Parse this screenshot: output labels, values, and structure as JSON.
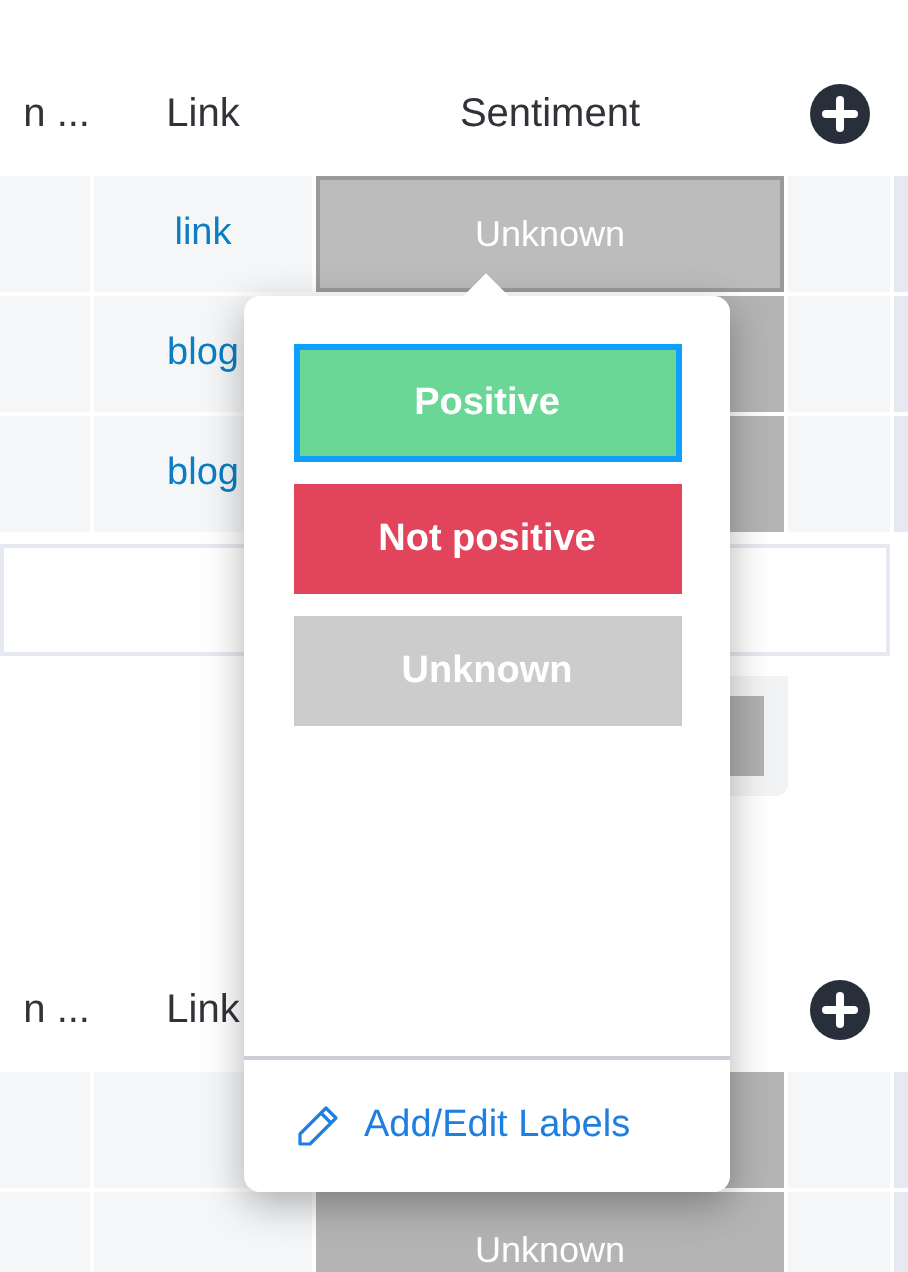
{
  "groups": [
    {
      "columns": [
        "n ...",
        "Link",
        "Sentiment"
      ],
      "rows": [
        {
          "link": "link",
          "sentiment": "Unknown",
          "focused": true
        },
        {
          "link": "blog",
          "focused": false
        },
        {
          "link": "blog",
          "focused": false
        }
      ],
      "summary": true
    },
    {
      "columns": [
        "n ...",
        "Link"
      ],
      "rows": [
        {
          "link": "",
          "focused": false
        },
        {
          "link": "",
          "sentiment": "Unknown",
          "focused": false
        }
      ],
      "summary": false
    }
  ],
  "picker": {
    "labels": [
      {
        "label": "Positive",
        "color": "#6bd797",
        "selected": true
      },
      {
        "label": "Not positive",
        "color": "#e2445c",
        "selected": false
      },
      {
        "label": "Unknown",
        "color": "#cccccc",
        "selected": false
      }
    ],
    "footer": "Add/Edit Labels"
  }
}
